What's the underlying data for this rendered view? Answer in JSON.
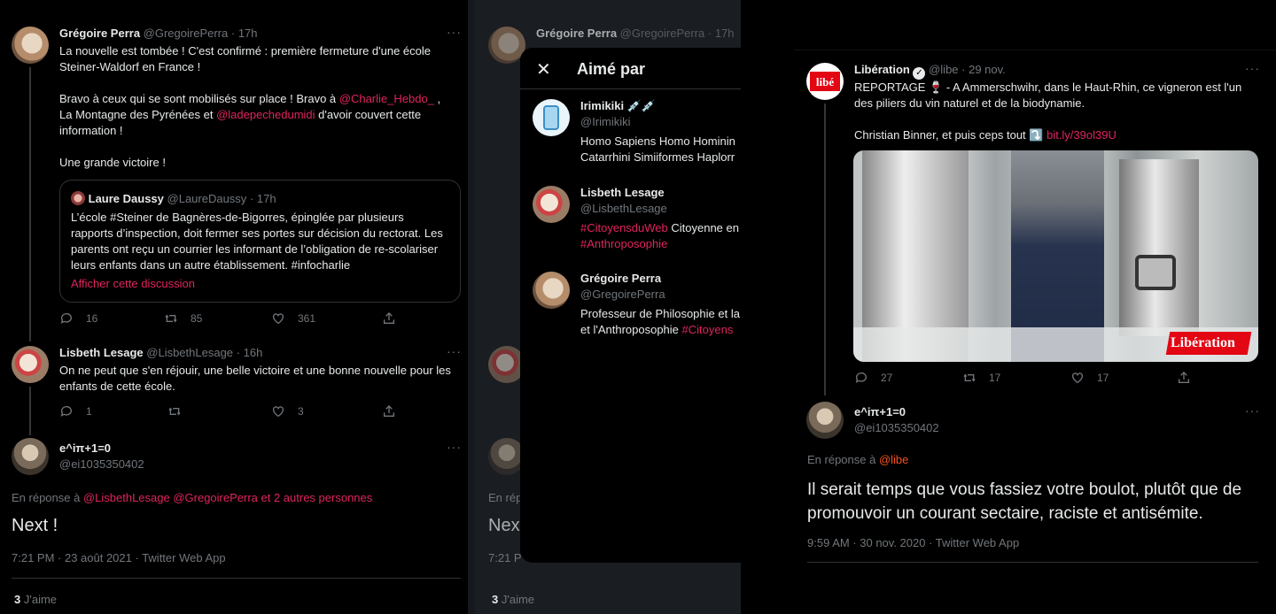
{
  "panel1": {
    "tweet1": {
      "name": "Grégoire Perra",
      "handle": "@GregoirePerra",
      "time": "· 17h",
      "text1": "La nouvelle est tombée ! C'est confirmé : première fermeture d'une école Steiner-Waldorf en France !",
      "text2a": "Bravo à  ceux qui se sont mobilisés sur place ! Bravo à ",
      "mention1": "@Charlie_Hebdo_",
      "text2b": " ,",
      "text2c": "La Montagne des Pyrénées et ",
      "mention2": "@ladepechedumidi",
      "text2d": " d'avoir couvert cette information !",
      "text3": "Une grande victoire !",
      "quote": {
        "name": "Laure Daussy",
        "handle": "@LaureDaussy",
        "time": "· 17h",
        "text": "L’école #Steiner de Bagnères-de-Bigorres, épinglée par plusieurs rapports d’inspection, doit fermer ses portes sur décision du rectorat. Les parents ont reçu un courrier les informant de l’obligation de re-scolariser leurs enfants dans un autre établissement. #infocharlie",
        "link": "Afficher cette discussion"
      },
      "replies": "16",
      "retweets": "85",
      "likes": "361"
    },
    "tweet2": {
      "name": "Lisbeth Lesage",
      "handle": "@LisbethLesage",
      "time": "· 16h",
      "text": "On ne peut que s'en réjouir, une belle victoire et une bonne nouvelle pour les enfants de cette école.",
      "replies": "1",
      "retweets": "",
      "likes": "3"
    },
    "tweet3": {
      "name": "e^iπ+1=0",
      "handle": "@ei1035350402",
      "reply_prefix": "En réponse à ",
      "reply_to": "@LisbethLesage @GregoirePerra  et 2 autres personnes",
      "text": "Next !",
      "meta": "7:21 PM · 23 août 2021 · Twitter Web App",
      "likes_count": "3",
      "likes_label": "J'aime"
    }
  },
  "panel2": {
    "bg_name": "Grégoire Perra",
    "bg_handle": "@GregoirePerra",
    "bg_time": "· 17h",
    "bg_text_a": "Nex",
    "bg_text_b": "En rép",
    "bg_meta": "7:21 P",
    "bg_likes_count": "3",
    "bg_likes_label": "J'aime",
    "modal": {
      "title": "Aimé par",
      "users": [
        {
          "name": "Irimikiki 💉💉",
          "handle": "@Irimikiki",
          "bio": "Homo Sapiens Homo Hominin",
          "bio2": "Catarrhini Simiiformes Haplorr",
          "tag": "",
          "bio_b": ""
        },
        {
          "name": "Lisbeth Lesage",
          "handle": "@LisbethLesage",
          "bio": "",
          "bio2": "",
          "tag": "#CitoyensduWeb",
          "bio_b": " Citoyenne en",
          "tag2": "#Anthroposophie"
        },
        {
          "name": "Grégoire Perra",
          "handle": "@GregoirePerra",
          "bio": "Professeur de Philosophie et la",
          "bio2": "et l'Anthroposophie ",
          "tag": "#Citoyens",
          "bio_b": ""
        }
      ]
    }
  },
  "panel3": {
    "tweet1": {
      "name": "Libération",
      "handle": "@libe",
      "time": "· 29 nov.",
      "text1": "REPORTAGE 🍷 - A Ammerschwihr, dans le Haut-Rhin, ce vigneron est l'un des piliers du vin naturel et de la biodynamie.",
      "text2": "Christian Binner, et puis ceps tout ⤵️ ",
      "link": "bit.ly/39ol39U",
      "image_watermark": "Libération",
      "replies": "27",
      "retweets": "17",
      "likes": "17"
    },
    "tweet2": {
      "name": "e^iπ+1=0",
      "handle": "@ei1035350402",
      "reply_prefix": "En réponse à ",
      "reply_to": "@libe",
      "text": "Il serait temps que vous fassiez votre boulot, plutôt que de promouvoir un courant sectaire, raciste et antisémite.",
      "meta": "9:59 AM · 30 nov. 2020 · Twitter Web App"
    }
  },
  "colors": {
    "background": "#000000",
    "accent": "#e0245e",
    "muted": "#71767b",
    "text": "#e7e9ea",
    "orange_link": "#f4511e"
  }
}
